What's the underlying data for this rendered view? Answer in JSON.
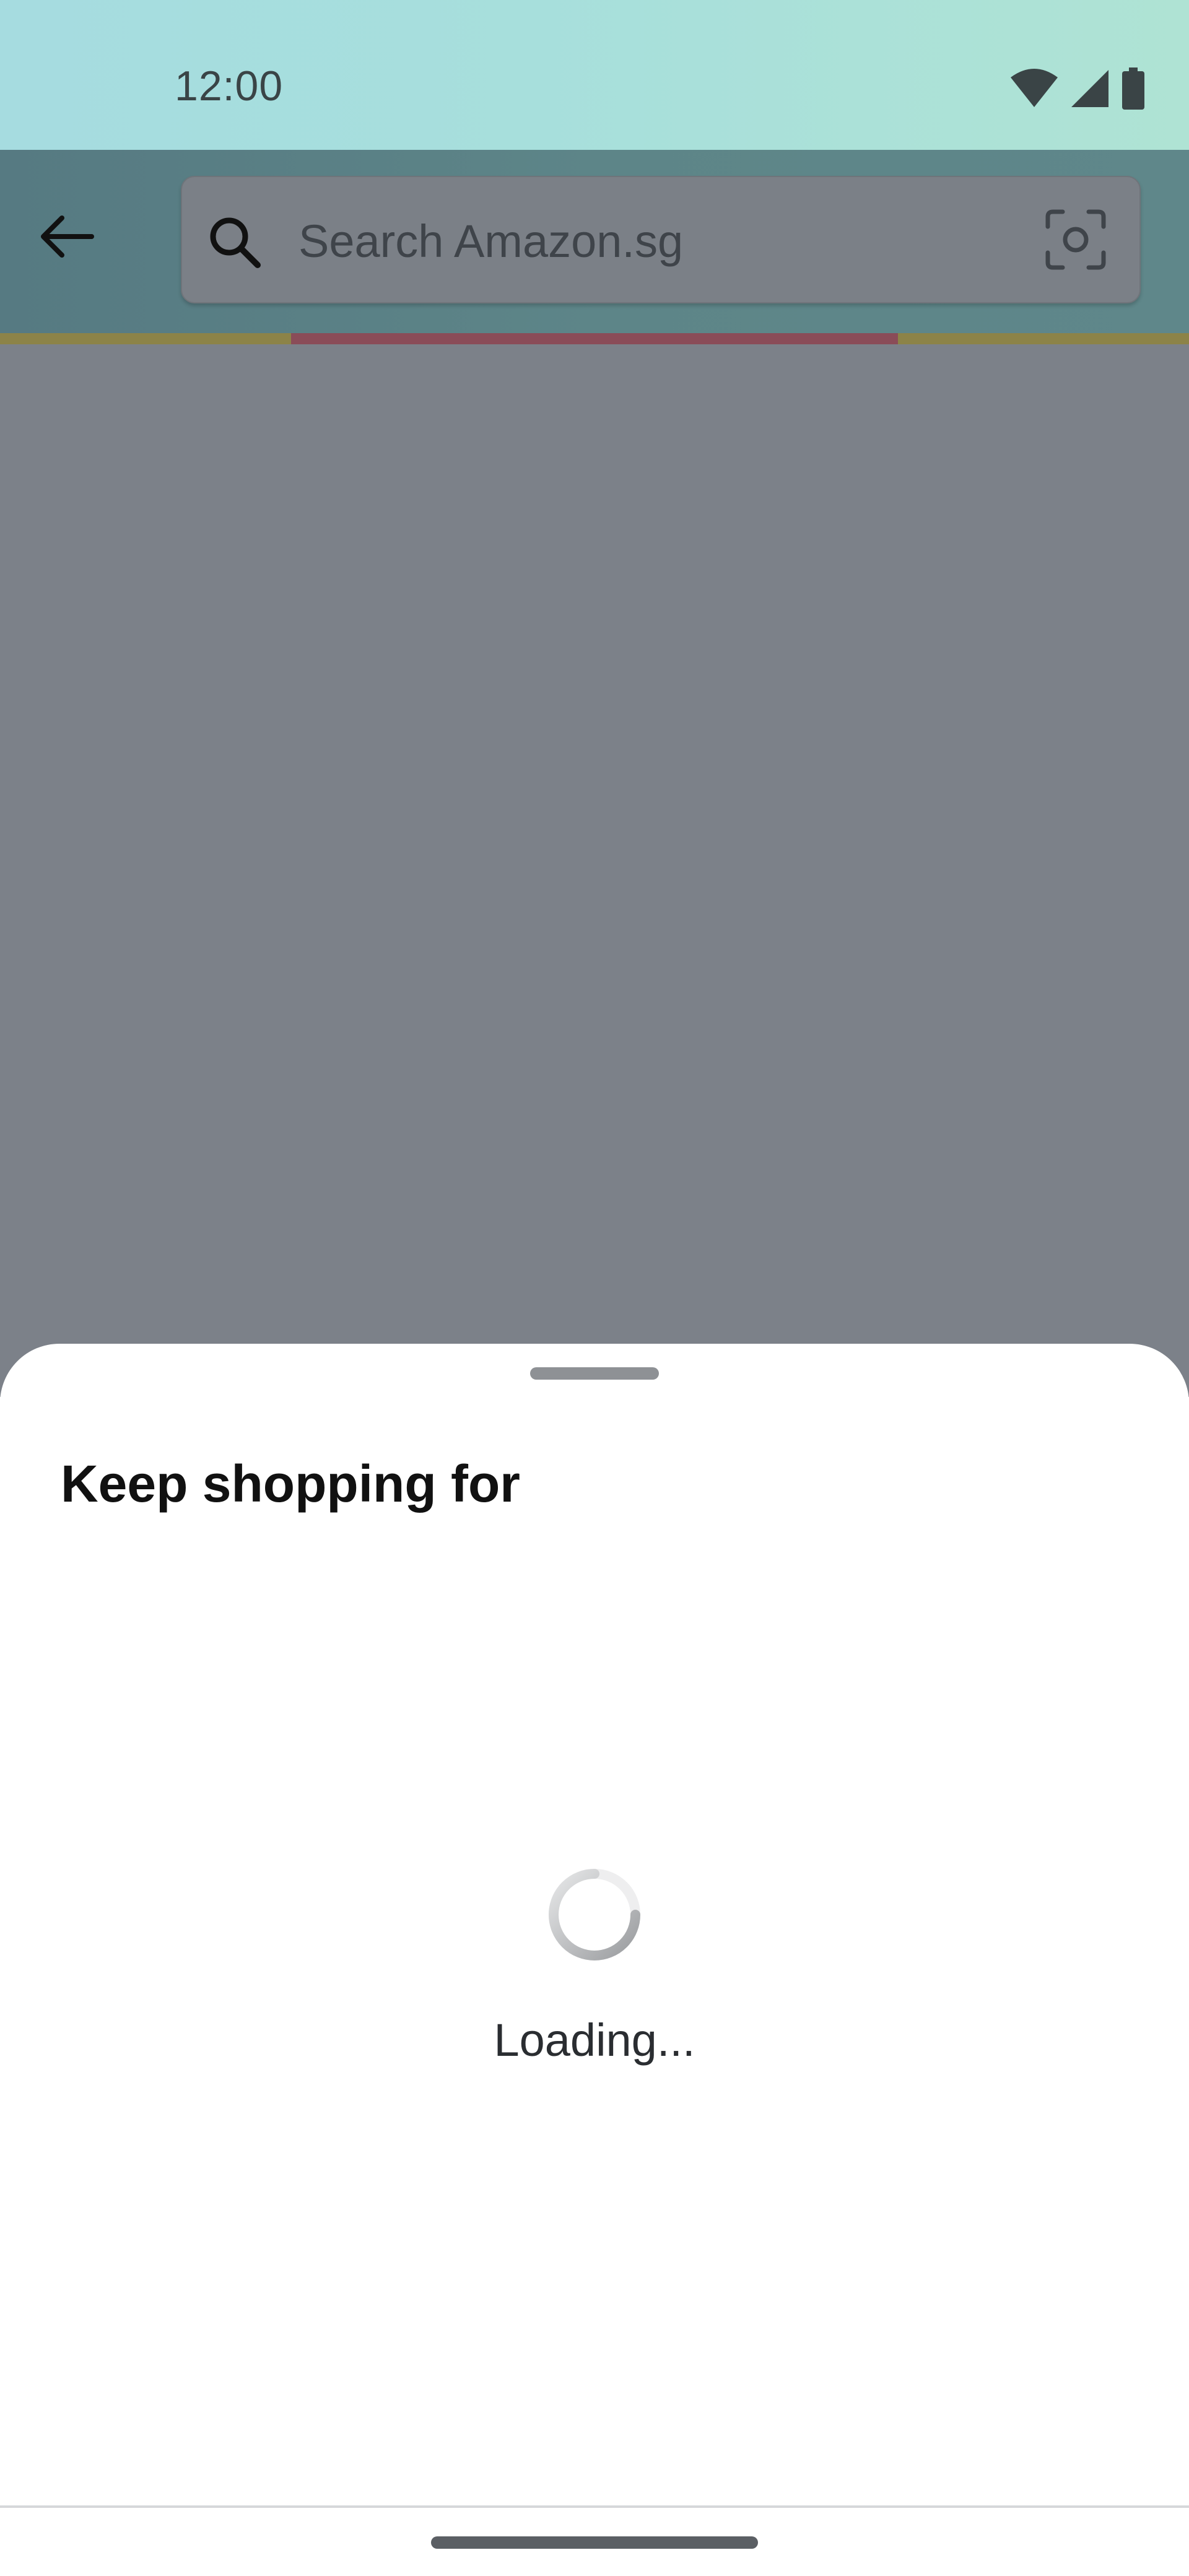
{
  "status_bar": {
    "time": "12:00",
    "icons": [
      "wifi-icon",
      "cellular-signal-icon",
      "battery-icon"
    ]
  },
  "header": {
    "back_icon": "arrow-left-icon",
    "search": {
      "placeholder": "Search Amazon.sg",
      "value": "",
      "left_icon": "search-icon",
      "right_icon": "camera-lens-icon"
    }
  },
  "bottom_sheet": {
    "title": "Keep shopping for",
    "loading_label": "Loading..."
  },
  "colors": {
    "status_bar": "#a7dfdc",
    "header": "#5d8588",
    "scrim": "#7c8189",
    "accent_strip": "#8c8348",
    "accent_strip_mid": "#8a4c58",
    "sheet": "#ffffff"
  }
}
